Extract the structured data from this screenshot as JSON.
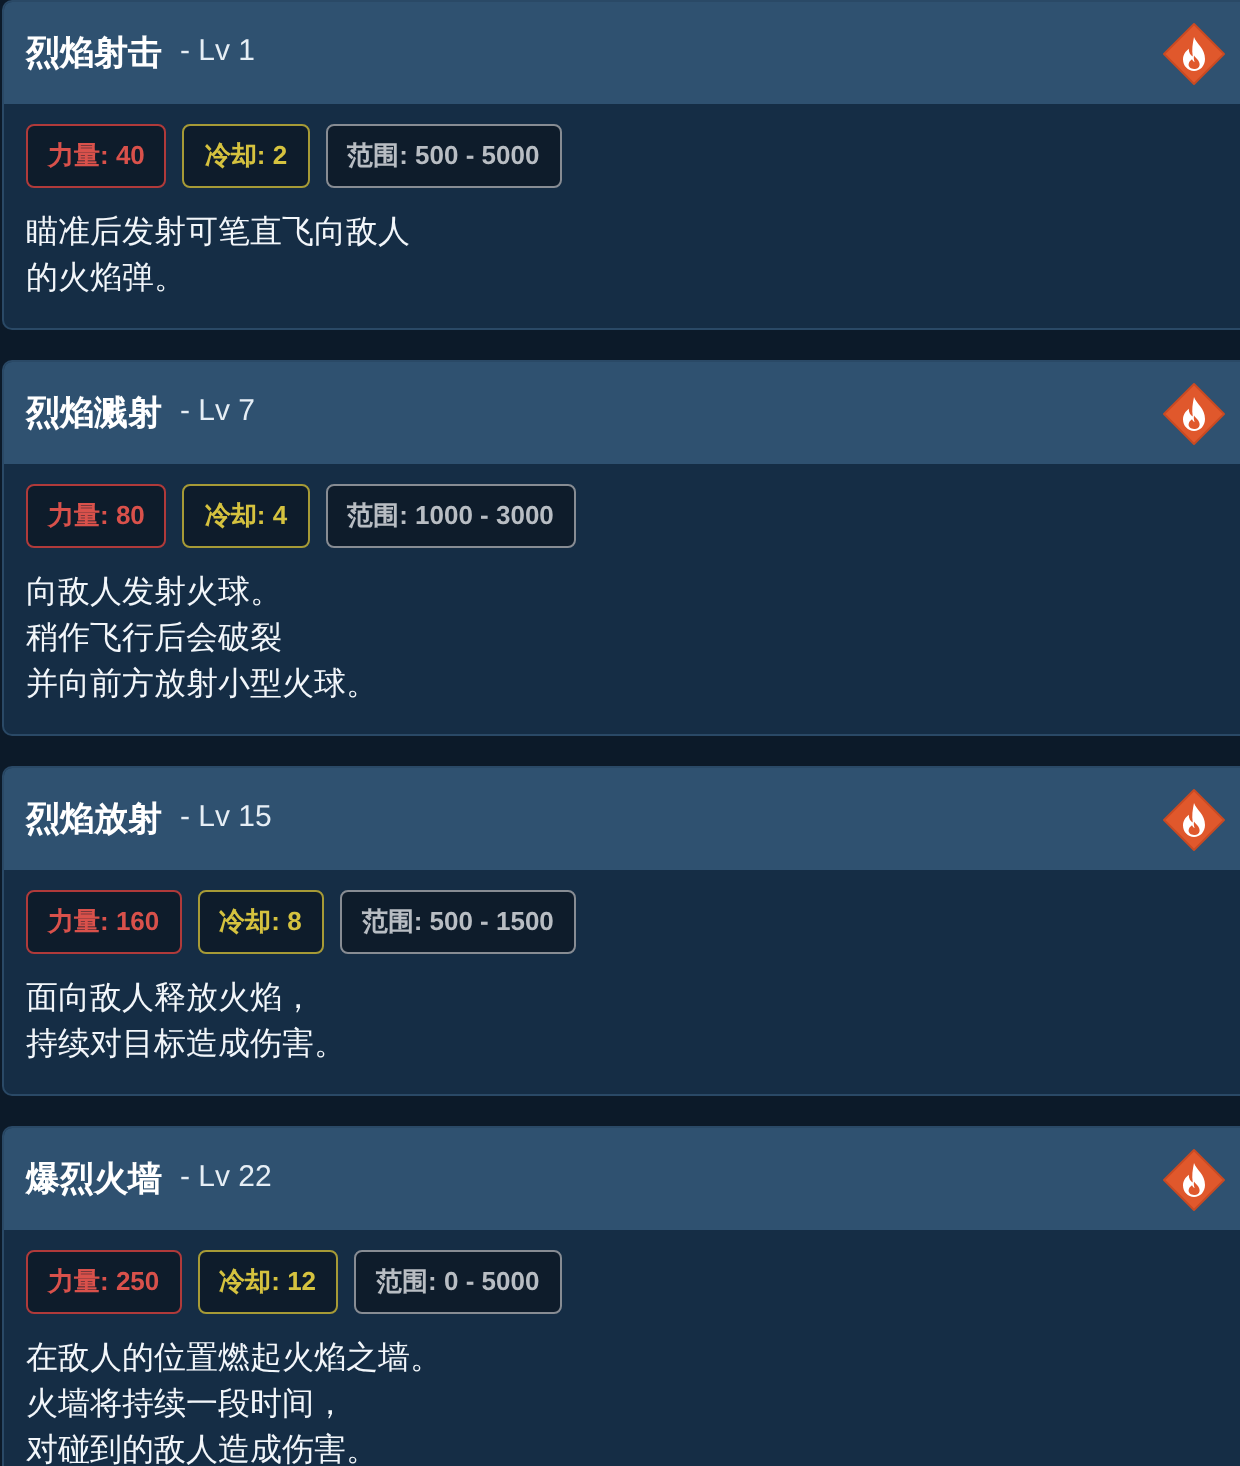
{
  "skills": [
    {
      "name": "烈焰射击",
      "level": "- Lv 1",
      "stats": [
        {
          "kind": "power",
          "text": "力量: 40"
        },
        {
          "kind": "cooldown",
          "text": "冷却: 2"
        },
        {
          "kind": "range",
          "text": "范围: 500 - 5000"
        }
      ],
      "description": [
        "瞄准后发射可笔直飞向敌人",
        "的火焰弹。"
      ]
    },
    {
      "name": "烈焰溅射",
      "level": "- Lv 7",
      "stats": [
        {
          "kind": "power",
          "text": "力量: 80"
        },
        {
          "kind": "cooldown",
          "text": "冷却: 4"
        },
        {
          "kind": "range",
          "text": "范围: 1000 - 3000"
        }
      ],
      "description": [
        "向敌人发射火球。",
        "稍作飞行后会破裂",
        "并向前方放射小型火球。"
      ]
    },
    {
      "name": "烈焰放射",
      "level": "- Lv 15",
      "stats": [
        {
          "kind": "power",
          "text": "力量: 160"
        },
        {
          "kind": "cooldown",
          "text": "冷却: 8"
        },
        {
          "kind": "range",
          "text": "范围: 500 - 1500"
        }
      ],
      "description": [
        "面向敌人释放火焰，",
        "持续对目标造成伤害。"
      ]
    },
    {
      "name": "爆烈火墙",
      "level": "- Lv 22",
      "stats": [
        {
          "kind": "power",
          "text": "力量: 250"
        },
        {
          "kind": "cooldown",
          "text": "冷却: 12"
        },
        {
          "kind": "range",
          "text": "范围: 0 - 5000"
        }
      ],
      "description": [
        "在敌人的位置燃起火焰之墙。",
        "火墙将持续一段时间，",
        "对碰到的敌人造成伤害。"
      ]
    }
  ]
}
